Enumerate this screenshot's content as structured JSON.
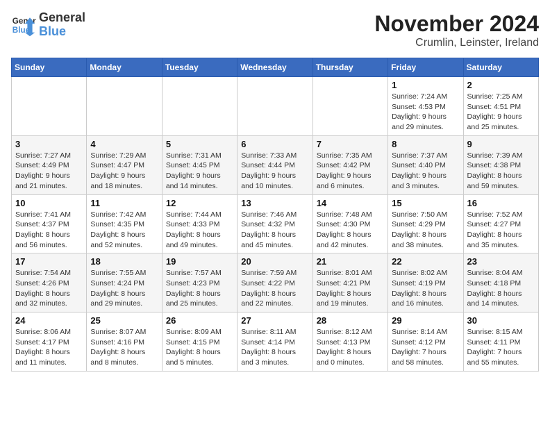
{
  "logo": {
    "general": "General",
    "blue": "Blue"
  },
  "title": "November 2024",
  "subtitle": "Crumlin, Leinster, Ireland",
  "days_header": [
    "Sunday",
    "Monday",
    "Tuesday",
    "Wednesday",
    "Thursday",
    "Friday",
    "Saturday"
  ],
  "weeks": [
    [
      {
        "day": "",
        "info": ""
      },
      {
        "day": "",
        "info": ""
      },
      {
        "day": "",
        "info": ""
      },
      {
        "day": "",
        "info": ""
      },
      {
        "day": "",
        "info": ""
      },
      {
        "day": "1",
        "info": "Sunrise: 7:24 AM\nSunset: 4:53 PM\nDaylight: 9 hours and 29 minutes."
      },
      {
        "day": "2",
        "info": "Sunrise: 7:25 AM\nSunset: 4:51 PM\nDaylight: 9 hours and 25 minutes."
      }
    ],
    [
      {
        "day": "3",
        "info": "Sunrise: 7:27 AM\nSunset: 4:49 PM\nDaylight: 9 hours and 21 minutes."
      },
      {
        "day": "4",
        "info": "Sunrise: 7:29 AM\nSunset: 4:47 PM\nDaylight: 9 hours and 18 minutes."
      },
      {
        "day": "5",
        "info": "Sunrise: 7:31 AM\nSunset: 4:45 PM\nDaylight: 9 hours and 14 minutes."
      },
      {
        "day": "6",
        "info": "Sunrise: 7:33 AM\nSunset: 4:44 PM\nDaylight: 9 hours and 10 minutes."
      },
      {
        "day": "7",
        "info": "Sunrise: 7:35 AM\nSunset: 4:42 PM\nDaylight: 9 hours and 6 minutes."
      },
      {
        "day": "8",
        "info": "Sunrise: 7:37 AM\nSunset: 4:40 PM\nDaylight: 9 hours and 3 minutes."
      },
      {
        "day": "9",
        "info": "Sunrise: 7:39 AM\nSunset: 4:38 PM\nDaylight: 8 hours and 59 minutes."
      }
    ],
    [
      {
        "day": "10",
        "info": "Sunrise: 7:41 AM\nSunset: 4:37 PM\nDaylight: 8 hours and 56 minutes."
      },
      {
        "day": "11",
        "info": "Sunrise: 7:42 AM\nSunset: 4:35 PM\nDaylight: 8 hours and 52 minutes."
      },
      {
        "day": "12",
        "info": "Sunrise: 7:44 AM\nSunset: 4:33 PM\nDaylight: 8 hours and 49 minutes."
      },
      {
        "day": "13",
        "info": "Sunrise: 7:46 AM\nSunset: 4:32 PM\nDaylight: 8 hours and 45 minutes."
      },
      {
        "day": "14",
        "info": "Sunrise: 7:48 AM\nSunset: 4:30 PM\nDaylight: 8 hours and 42 minutes."
      },
      {
        "day": "15",
        "info": "Sunrise: 7:50 AM\nSunset: 4:29 PM\nDaylight: 8 hours and 38 minutes."
      },
      {
        "day": "16",
        "info": "Sunrise: 7:52 AM\nSunset: 4:27 PM\nDaylight: 8 hours and 35 minutes."
      }
    ],
    [
      {
        "day": "17",
        "info": "Sunrise: 7:54 AM\nSunset: 4:26 PM\nDaylight: 8 hours and 32 minutes."
      },
      {
        "day": "18",
        "info": "Sunrise: 7:55 AM\nSunset: 4:24 PM\nDaylight: 8 hours and 29 minutes."
      },
      {
        "day": "19",
        "info": "Sunrise: 7:57 AM\nSunset: 4:23 PM\nDaylight: 8 hours and 25 minutes."
      },
      {
        "day": "20",
        "info": "Sunrise: 7:59 AM\nSunset: 4:22 PM\nDaylight: 8 hours and 22 minutes."
      },
      {
        "day": "21",
        "info": "Sunrise: 8:01 AM\nSunset: 4:21 PM\nDaylight: 8 hours and 19 minutes."
      },
      {
        "day": "22",
        "info": "Sunrise: 8:02 AM\nSunset: 4:19 PM\nDaylight: 8 hours and 16 minutes."
      },
      {
        "day": "23",
        "info": "Sunrise: 8:04 AM\nSunset: 4:18 PM\nDaylight: 8 hours and 14 minutes."
      }
    ],
    [
      {
        "day": "24",
        "info": "Sunrise: 8:06 AM\nSunset: 4:17 PM\nDaylight: 8 hours and 11 minutes."
      },
      {
        "day": "25",
        "info": "Sunrise: 8:07 AM\nSunset: 4:16 PM\nDaylight: 8 hours and 8 minutes."
      },
      {
        "day": "26",
        "info": "Sunrise: 8:09 AM\nSunset: 4:15 PM\nDaylight: 8 hours and 5 minutes."
      },
      {
        "day": "27",
        "info": "Sunrise: 8:11 AM\nSunset: 4:14 PM\nDaylight: 8 hours and 3 minutes."
      },
      {
        "day": "28",
        "info": "Sunrise: 8:12 AM\nSunset: 4:13 PM\nDaylight: 8 hours and 0 minutes."
      },
      {
        "day": "29",
        "info": "Sunrise: 8:14 AM\nSunset: 4:12 PM\nDaylight: 7 hours and 58 minutes."
      },
      {
        "day": "30",
        "info": "Sunrise: 8:15 AM\nSunset: 4:11 PM\nDaylight: 7 hours and 55 minutes."
      }
    ]
  ]
}
